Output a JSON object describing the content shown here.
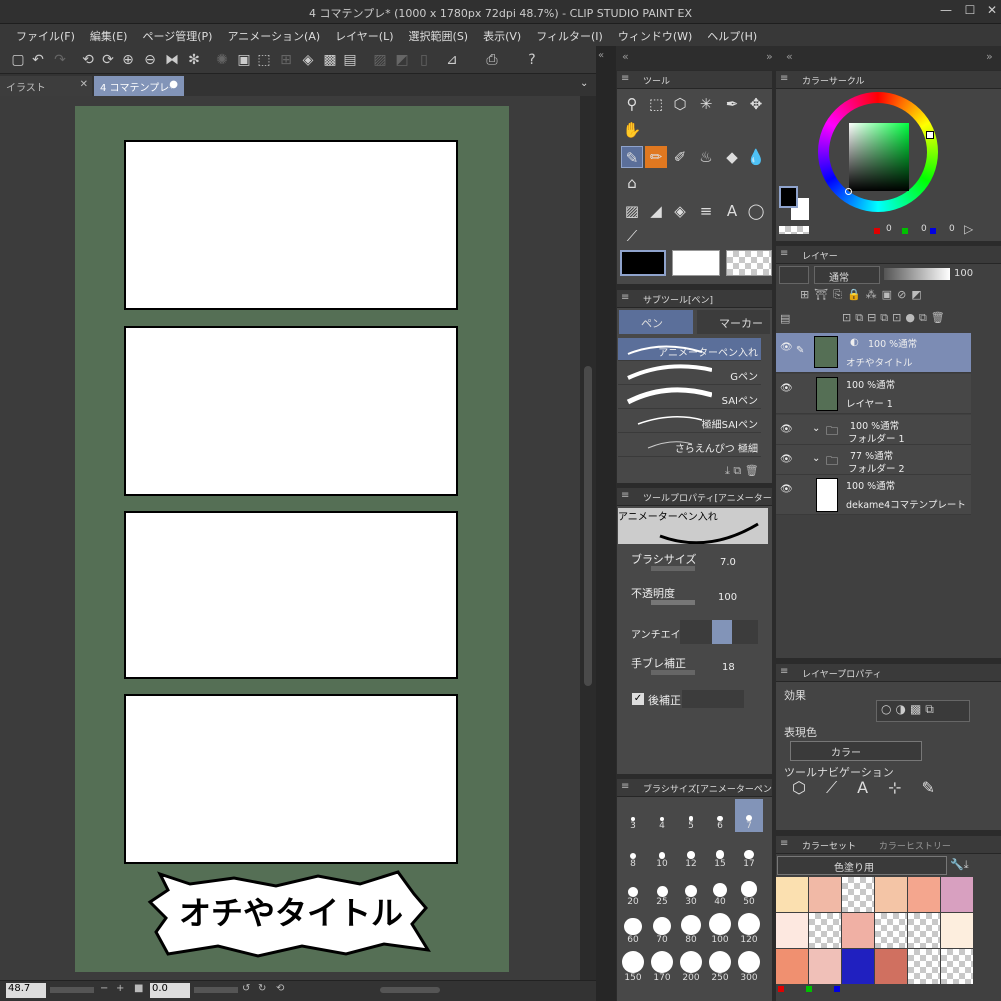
{
  "title": "4 コマテンプレ* (1000 x 1780px 72dpi 48.7%)  - CLIP STUDIO PAINT EX",
  "menu": [
    "ファイル(F)",
    "編集(E)",
    "ページ管理(P)",
    "アニメーション(A)",
    "レイヤー(L)",
    "選択範囲(S)",
    "表示(V)",
    "フィルター(I)",
    "ウィンドウ(W)",
    "ヘルプ(H)"
  ],
  "tabs": [
    "イラスト",
    "4 コマテンプレ*"
  ],
  "canvas": {
    "caption": "オチやタイトル"
  },
  "status": {
    "zoom": "48.7",
    "angle": "0.0"
  },
  "tool_panel": {
    "title": "ツール"
  },
  "subtool_panel": {
    "title": "サブツール[ペン]",
    "tab_pen": "ペン",
    "tab_marker": "マーカー",
    "brushes": [
      "アニメーターペン入れ",
      "Gペン",
      "SAIペン",
      "極細SAIペン",
      "さらえんぴつ 極細"
    ]
  },
  "tool_property": {
    "title": "ツールプロパティ[アニメーターペン入",
    "brush_name": "アニメーターペン入れ",
    "brush_size_label": "ブラシサイズ",
    "brush_size": "7.0",
    "opacity_label": "不透明度",
    "opacity": "100",
    "antialias_label": "アンチエイリア",
    "stabilization_label": "手ブレ補正",
    "stabilization": "18",
    "post_correction_label": "後補正"
  },
  "brush_size_panel": {
    "title": "ブラシサイズ[アニメーターペン入れ",
    "sizes": [
      "3",
      "4",
      "5",
      "6",
      "7",
      "8",
      "10",
      "12",
      "15",
      "17",
      "20",
      "25",
      "30",
      "40",
      "50",
      "60",
      "70",
      "80",
      "100",
      "120",
      "150",
      "170",
      "200",
      "250",
      "300"
    ],
    "selected": "7"
  },
  "color_circle": {
    "title": "カラーサークル",
    "r": "0",
    "g": "0",
    "b": "0",
    "main_color": "#000000",
    "sub_color": "#ffffff"
  },
  "layer_panel": {
    "title": "レイヤー",
    "blend": "通常",
    "opacity": "100",
    "layers": [
      {
        "line1": "100 %通常",
        "line2": "オチやタイトル"
      },
      {
        "line1": "100 %通常",
        "line2": "レイヤー 1"
      },
      {
        "line1": "100 %通常",
        "line2": "フォルダー 1"
      },
      {
        "line1": "77 %通常",
        "line2": "フォルダー 2"
      },
      {
        "line1": "100 %通常",
        "line2": "dekame4コマテンプレート"
      }
    ]
  },
  "layer_property": {
    "title": "レイヤープロパティ",
    "effect": "効果",
    "expression_color": "表現色",
    "color_option": "カラー",
    "tool_nav": "ツールナビゲーション"
  },
  "color_set": {
    "title": "カラーセット",
    "history_tab": "カラーヒストリー",
    "set_name": "色塗り用",
    "swatches": [
      [
        "#fbe0b0",
        "#f1b9a6",
        "checker",
        "#f4c5a6",
        "#f4a68e",
        "#d8a0c0"
      ],
      [
        "#fde8e0",
        "checker",
        "#f0b0a4",
        "checker",
        "checker",
        "#fdeede"
      ],
      [
        "#f09070",
        "#f0c0b8",
        "#2020c0",
        "#d07060",
        "checker",
        "checker"
      ]
    ]
  }
}
